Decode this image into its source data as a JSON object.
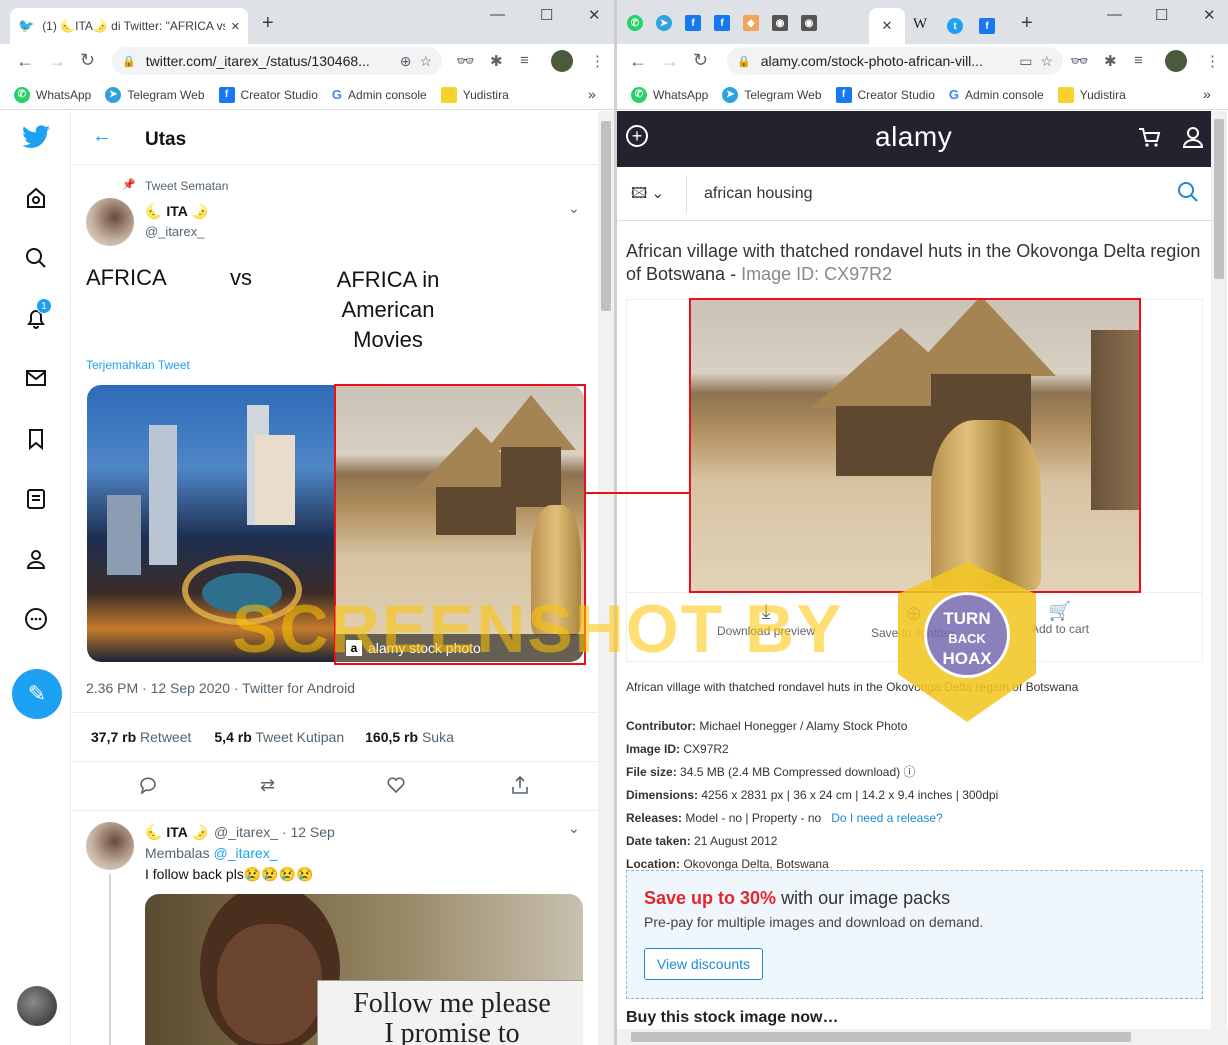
{
  "left_window": {
    "tab": {
      "title": "(1) 🌜ITA🌛 di Twitter: \"AFRICA vs",
      "close": "✕"
    },
    "new_tab": "+",
    "url": "twitter.com/_itarex_/status/130468...",
    "bookmarks": [
      {
        "label": "WhatsApp",
        "icon": "whatsapp-icon",
        "color": "#25d366"
      },
      {
        "label": "Telegram Web",
        "icon": "telegram-icon",
        "color": "#2ea3dd"
      },
      {
        "label": "Creator Studio",
        "icon": "facebook-icon",
        "color": "#1877f2"
      },
      {
        "label": "Admin console",
        "icon": "google-icon",
        "color": "#4285f4"
      },
      {
        "label": "Yudistira",
        "icon": "yudistira-icon",
        "color": "#f6d32d"
      }
    ],
    "more_bookmarks": "»"
  },
  "twitter": {
    "header_title": "Utas",
    "notification_count": "1",
    "pinned_label": "Tweet Sematan",
    "author_name": "🌜 ITA 🌛",
    "author_handle": "@_itarex_",
    "tweet_text_left": "AFRICA",
    "tweet_text_vs": "vs",
    "tweet_text_right": "AFRICA in\nAmerican\nMovies",
    "translate_label": "Terjemahkan Tweet",
    "image_right_caption": "alamy stock photo",
    "timestamp": "2.36 PM · 12 Sep 2020 · Twitter for Android",
    "stats": [
      {
        "value": "37,7 rb",
        "label": "Retweet"
      },
      {
        "value": "5,4 rb",
        "label": "Tweet Kutipan"
      },
      {
        "value": "160,5 rb",
        "label": "Suka"
      }
    ],
    "reply": {
      "author_name": "🌜 ITA 🌛",
      "handle_time": "@_itarex_ · 12 Sep",
      "replying_prefix": "Membalas",
      "replying_to": "@_itarex_",
      "text": "I follow back pls😢😢😢😢",
      "meme_text_line1": "Follow me please",
      "meme_text_line2": "I promise to"
    },
    "accent_color": "#1da1f2"
  },
  "right_window": {
    "url": "alamy.com/stock-photo-african-vill...",
    "active_tab_close": "✕",
    "new_tab": "+",
    "bookmarks": [
      {
        "label": "WhatsApp",
        "icon": "whatsapp-icon",
        "color": "#25d366"
      },
      {
        "label": "Telegram Web",
        "icon": "telegram-icon",
        "color": "#2ea3dd"
      },
      {
        "label": "Creator Studio",
        "icon": "facebook-icon",
        "color": "#1877f2"
      },
      {
        "label": "Admin console",
        "icon": "google-icon",
        "color": "#4285f4"
      },
      {
        "label": "Yudistira",
        "icon": "yudistira-icon",
        "color": "#f6d32d"
      }
    ],
    "more_bookmarks": "»"
  },
  "alamy": {
    "logo": "alamy",
    "search_value": "african housing",
    "title": "African village with thatched rondavel huts in the Okovonga Delta region of Botswana",
    "title_sep": " - ",
    "image_id_label": "Image ID: CX97R2",
    "actions": [
      "Download preview",
      "Save to lightbox",
      "Add to cart"
    ],
    "caption": "African village with thatched rondavel huts in the Okovonga Delta region of Botswana",
    "details": [
      {
        "key": "Contributor:",
        "value": "Michael Honegger / Alamy Stock Photo"
      },
      {
        "key": "Image ID:",
        "value": "CX97R2"
      },
      {
        "key": "File size:",
        "value": "34.5 MB (2.4 MB Compressed download)"
      },
      {
        "key": "Dimensions:",
        "value": "4256 x 2831 px | 36 x 24 cm | 14.2 x 9.4 inches | 300dpi"
      },
      {
        "key": "Releases:",
        "value": "Model - no | Property - no"
      },
      {
        "key": "Date taken:",
        "value": "21 August 2012"
      },
      {
        "key": "Location:",
        "value": "Okovonga Delta, Botswana"
      }
    ],
    "release_link": "Do I need a release?",
    "promo_highlight": "Save up to 30%",
    "promo_rest": "with our image packs",
    "promo_sub": "Pre-pay for multiple images and download on demand.",
    "promo_button": "View discounts",
    "buy_heading": "Buy this stock image now…",
    "header_color": "#22232e",
    "promo_color": "#e3262e"
  },
  "overlay": {
    "watermark": "SCREENSHOT BY",
    "badge_line1": "TURN",
    "badge_line2": "BACK",
    "badge_line3": "HOAX"
  }
}
